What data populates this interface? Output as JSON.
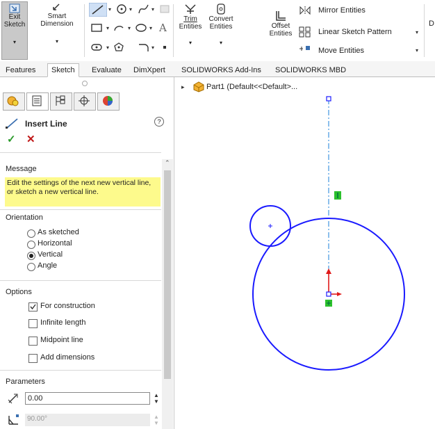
{
  "ribbon": {
    "exit_sketch": [
      "Exit",
      "Sketch"
    ],
    "smart_dimension": [
      "Smart",
      "Dimension"
    ],
    "trim": [
      "Trim",
      "Entities"
    ],
    "convert": [
      "Convert",
      "Entities"
    ],
    "offset": [
      "Offset",
      "Entities"
    ],
    "mirror": "Mirror Entities",
    "linear_pattern": "Linear Sketch Pattern",
    "move": "Move Entities",
    "overflow": "D"
  },
  "tabs": [
    "Features",
    "Sketch",
    "Evaluate",
    "DimXpert",
    "SOLIDWORKS Add-Ins",
    "SOLIDWORKS MBD"
  ],
  "active_tab": "Sketch",
  "property_manager": {
    "title": "Insert Line",
    "message_header": "Message",
    "message_text": "Edit the settings of the next new vertical line, or sketch a new vertical line.",
    "orientation_header": "Orientation",
    "orientation_options": [
      "As sketched",
      "Horizontal",
      "Vertical",
      "Angle"
    ],
    "orientation_selected": "Vertical",
    "options_header": "Options",
    "options": [
      {
        "label": "For construction",
        "checked": true
      },
      {
        "label": "Infinite length",
        "checked": false
      },
      {
        "label": "Midpoint line",
        "checked": false
      },
      {
        "label": "Add dimensions",
        "checked": false
      }
    ],
    "parameters_header": "Parameters",
    "length_value": "0.00",
    "angle_value": "90.00°"
  },
  "tree": {
    "part_label": "Part1  (Default<<Default>..."
  },
  "colors": {
    "sketch_blue": "#1a1aff",
    "message_bg": "#fdfa8c",
    "exit_bg": "#c9c9c9"
  }
}
